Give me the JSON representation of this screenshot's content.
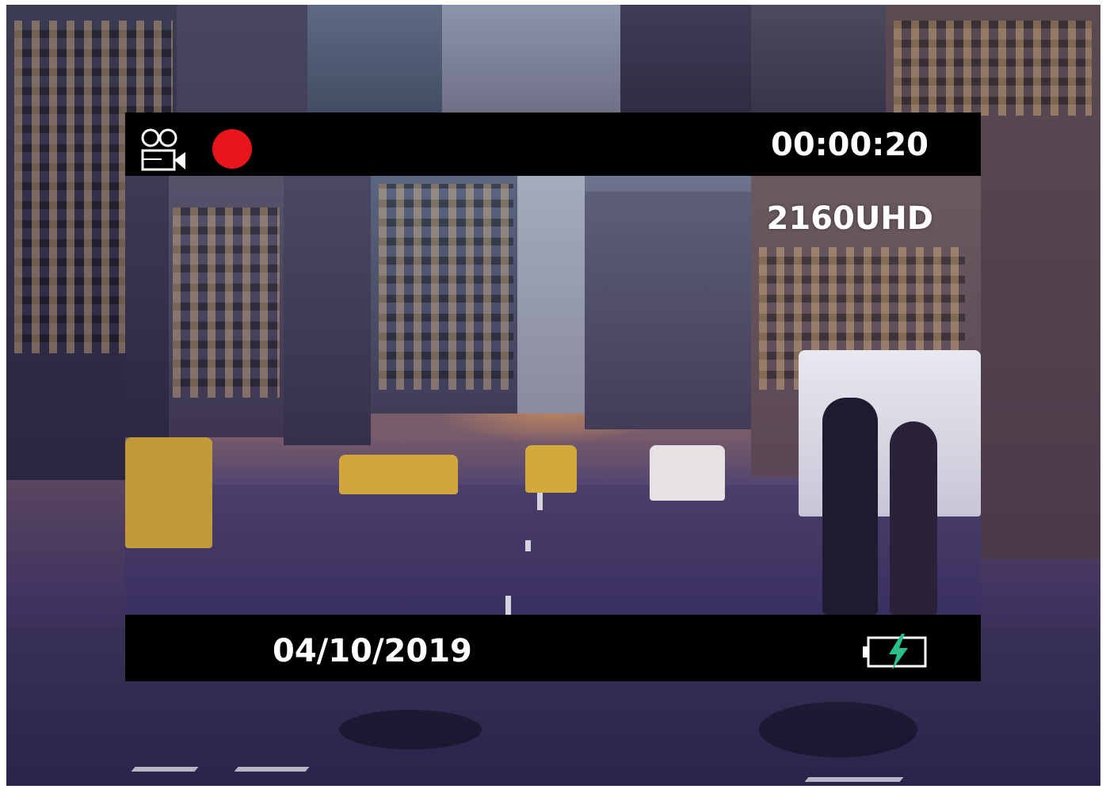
{
  "overlay": {
    "timer": "00:00:20",
    "resolution": "2160UHD",
    "date": "04/10/2019"
  },
  "icons": {
    "camera": "video-camera-icon",
    "recording": "record-dot-icon",
    "battery": "battery-charging-icon"
  },
  "colors": {
    "record": "#e8161b",
    "bars": "#000000",
    "text": "#ffffff",
    "charge_bolt": "#2bbf8a"
  }
}
